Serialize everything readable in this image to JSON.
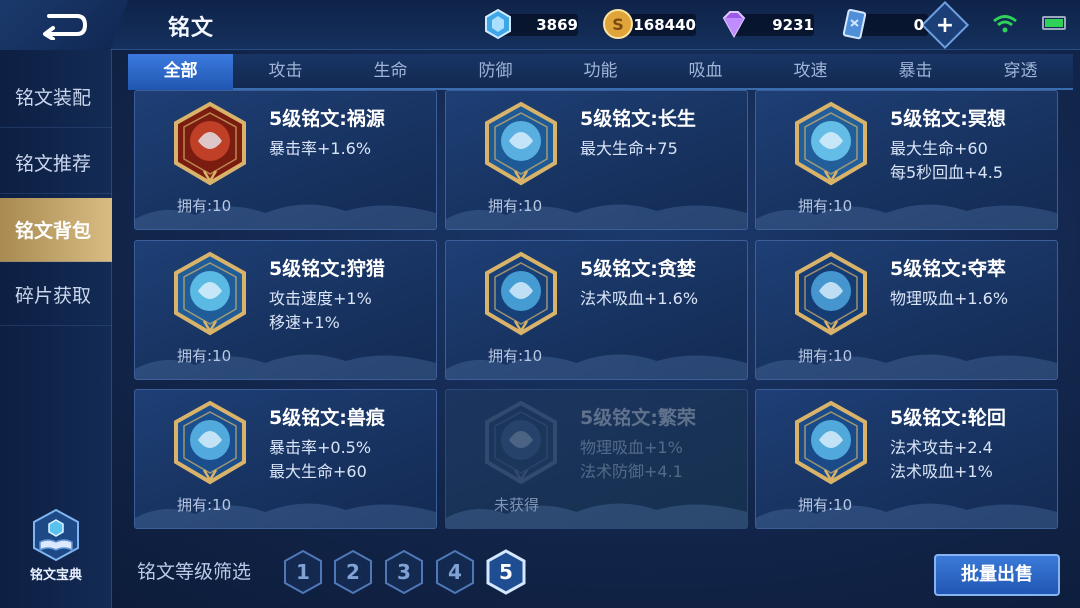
{
  "header": {
    "title": "铭文",
    "resources": [
      {
        "name": "diamond",
        "icon": "blue-crystal-icon",
        "value": "3869"
      },
      {
        "name": "gold",
        "icon": "gold-coin-icon",
        "value": "168440"
      },
      {
        "name": "gem",
        "icon": "purple-gem-icon",
        "value": "9231"
      },
      {
        "name": "ticket",
        "icon": "card-ticket-icon",
        "value": "0"
      }
    ]
  },
  "sidebar": {
    "items": [
      {
        "label": "铭文装配",
        "active": false
      },
      {
        "label": "铭文推荐",
        "active": false
      },
      {
        "label": "铭文背包",
        "active": true
      },
      {
        "label": "碎片获取",
        "active": false
      }
    ],
    "codex_label": "铭文宝典"
  },
  "tabs": [
    {
      "label": "全部",
      "active": true
    },
    {
      "label": "攻击"
    },
    {
      "label": "生命"
    },
    {
      "label": "防御"
    },
    {
      "label": "功能"
    },
    {
      "label": "吸血"
    },
    {
      "label": "攻速"
    },
    {
      "label": "暴击"
    },
    {
      "label": "穿透"
    }
  ],
  "cards": [
    {
      "name": "5级铭文:祸源",
      "stats": [
        "暴击率+1.6%"
      ],
      "owned": "拥有:10",
      "colors": [
        "#c8442a",
        "#7a1c10"
      ],
      "icon": "calamity-rune-icon"
    },
    {
      "name": "5级铭文:长生",
      "stats": [
        "最大生命+75"
      ],
      "owned": "拥有:10",
      "colors": [
        "#5fb8e8",
        "#1e5a96"
      ],
      "icon": "longevity-rune-icon"
    },
    {
      "name": "5级铭文:冥想",
      "stats": [
        "最大生命+60",
        "每5秒回血+4.5"
      ],
      "owned": "拥有:10",
      "colors": [
        "#6cc8ee",
        "#225f9a"
      ],
      "icon": "meditation-rune-icon"
    },
    {
      "name": "5级铭文:狩猎",
      "stats": [
        "攻击速度+1%",
        "移速+1%"
      ],
      "owned": "拥有:10",
      "colors": [
        "#62c4ec",
        "#1f5c98"
      ],
      "icon": "hunting-rune-icon"
    },
    {
      "name": "5级铭文:贪婪",
      "stats": [
        "法术吸血+1.6%"
      ],
      "owned": "拥有:10",
      "colors": [
        "#4aa6dc",
        "#173f78"
      ],
      "icon": "greed-rune-icon"
    },
    {
      "name": "5级铭文:夺萃",
      "stats": [
        "物理吸血+1.6%"
      ],
      "owned": "拥有:10",
      "colors": [
        "#4aa0d8",
        "#163c74"
      ],
      "icon": "extraction-rune-icon"
    },
    {
      "name": "5级铭文:兽痕",
      "stats": [
        "暴击率+0.5%",
        "最大生命+60"
      ],
      "owned": "拥有:10",
      "colors": [
        "#58b4e4",
        "#1b4e8c"
      ],
      "icon": "beast-mark-rune-icon"
    },
    {
      "name": "5级铭文:繁荣",
      "stats": [
        "物理吸血+1%",
        "法术防御+4.1"
      ],
      "owned": "未获得",
      "colors": [
        "#4a6a96",
        "#233a5e"
      ],
      "icon": "prosperity-rune-icon",
      "locked": true
    },
    {
      "name": "5级铭文:轮回",
      "stats": [
        "法术攻击+2.4",
        "法术吸血+1%"
      ],
      "owned": "拥有:10",
      "colors": [
        "#56b2e4",
        "#1a4a88"
      ],
      "icon": "reincarnation-rune-icon"
    }
  ],
  "filter": {
    "label": "铭文等级筛选",
    "levels": [
      "1",
      "2",
      "3",
      "4",
      "5"
    ],
    "selected": "5"
  },
  "bulk_sell_label": "批量出售",
  "colors": {
    "accent": "#3c7be0",
    "gold_frame": "#d9b36a",
    "sidebar_active": "#c9a96c"
  }
}
